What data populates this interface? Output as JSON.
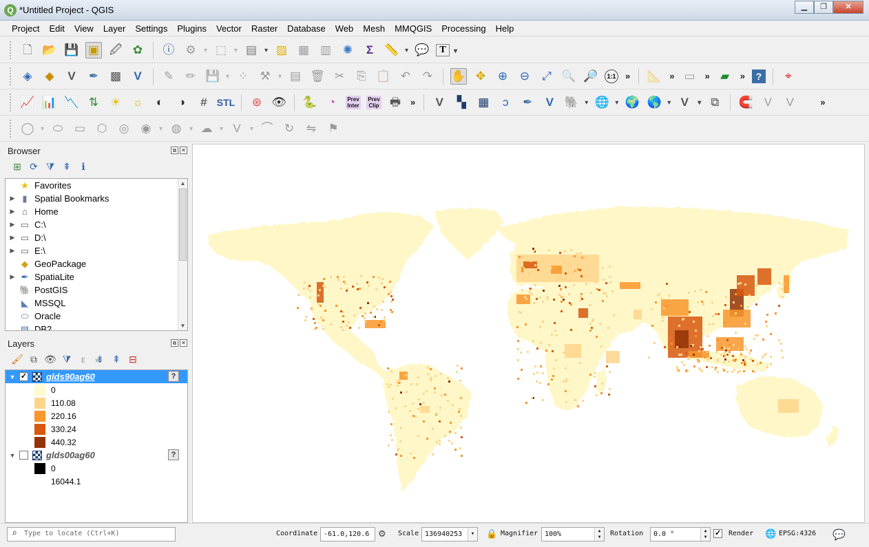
{
  "window": {
    "title": "*Untitled Project - QGIS",
    "logo": "Q"
  },
  "menu": [
    "Project",
    "Edit",
    "View",
    "Layer",
    "Settings",
    "Plugins",
    "Vector",
    "Raster",
    "Database",
    "Web",
    "Mesh",
    "MMQGIS",
    "Processing",
    "Help"
  ],
  "toolbar_text": {
    "prev_inter": "Prev Inter",
    "prev_clip": "Prev Clip",
    "stl": "STL",
    "sigma": "Σ",
    "text_tool": "T",
    "more": "»",
    "zoom_native": "1:1"
  },
  "browser": {
    "title": "Browser",
    "items": [
      {
        "label": "Favorites",
        "icon": "star-icon",
        "glyph": "★",
        "color": "#e8c200",
        "expandable": false
      },
      {
        "label": "Spatial Bookmarks",
        "icon": "bookmark-icon",
        "glyph": "▮",
        "color": "#6b7d99",
        "expandable": true
      },
      {
        "label": "Home",
        "icon": "home-icon",
        "glyph": "⌂",
        "color": "#555555",
        "expandable": true
      },
      {
        "label": "C:\\",
        "icon": "folder-icon",
        "glyph": "▭",
        "color": "#666666",
        "expandable": true
      },
      {
        "label": "D:\\",
        "icon": "folder-icon",
        "glyph": "▭",
        "color": "#666666",
        "expandable": true
      },
      {
        "label": "E:\\",
        "icon": "folder-icon",
        "glyph": "▭",
        "color": "#666666",
        "expandable": true
      },
      {
        "label": "GeoPackage",
        "icon": "geopackage-icon",
        "glyph": "◆",
        "color": "#d4a017",
        "expandable": false
      },
      {
        "label": "SpatiaLite",
        "icon": "spatialite-icon",
        "glyph": "✒",
        "color": "#3a6ea5",
        "expandable": true
      },
      {
        "label": "PostGIS",
        "icon": "postgis-icon",
        "glyph": "🐘",
        "color": "#336791",
        "expandable": false
      },
      {
        "label": "MSSQL",
        "icon": "mssql-icon",
        "glyph": "◣",
        "color": "#5a7fb0",
        "expandable": false
      },
      {
        "label": "Oracle",
        "icon": "oracle-icon",
        "glyph": "⬭",
        "color": "#3a6ea5",
        "expandable": false
      },
      {
        "label": "DB2",
        "icon": "db2-icon",
        "glyph": "▤",
        "color": "#3a6ea5",
        "expandable": false
      }
    ]
  },
  "layers": {
    "title": "Layers",
    "list": [
      {
        "name": "glds90ag60",
        "checked": true,
        "selected": true,
        "legend": [
          {
            "label": "0",
            "color": "#fffbd0"
          },
          {
            "label": "110.08",
            "color": "#fed58b"
          },
          {
            "label": "220.16",
            "color": "#f9962c"
          },
          {
            "label": "330.24",
            "color": "#d7580e"
          },
          {
            "label": "440.32",
            "color": "#943309"
          }
        ]
      },
      {
        "name": "glds00ag60",
        "checked": false,
        "selected": false,
        "legend": [
          {
            "label": "0",
            "color": "#000000"
          },
          {
            "label": "16044.1",
            "color": "#ffffff"
          }
        ]
      }
    ]
  },
  "status": {
    "locator_placeholder": "Type to locate (Ctrl+K)",
    "coordinate_label": "Coordinate",
    "coordinate_value": "-61.0,120.6",
    "scale_label": "Scale",
    "scale_value": "136940253",
    "magnifier_label": "Magnifier",
    "magnifier_value": "100%",
    "rotation_label": "Rotation",
    "rotation_value": "0.0 °",
    "render_label": "Render",
    "render_checked": true,
    "crs": "EPSG:4326"
  },
  "colors": {
    "map_base": "#fff7c8",
    "density_low": "#fed58b",
    "density_mid": "#f9962c",
    "density_high": "#d7580e",
    "density_max": "#943309"
  }
}
